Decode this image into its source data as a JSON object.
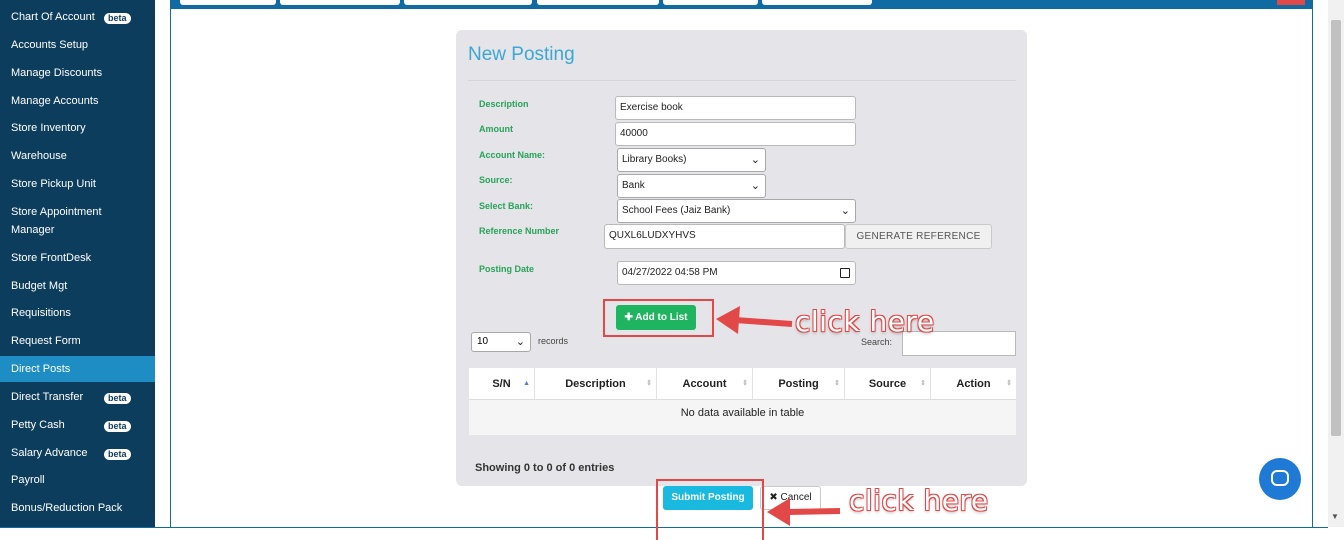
{
  "sidebar": {
    "items": [
      {
        "label": "Chart Of Account",
        "badge": "beta"
      },
      {
        "label": "Accounts Setup"
      },
      {
        "label": "Manage Discounts"
      },
      {
        "label": "Manage Accounts"
      },
      {
        "label": "Store Inventory"
      },
      {
        "label": "Warehouse"
      },
      {
        "label": "Store Pickup Unit"
      },
      {
        "label": "Store Appointment Manager"
      },
      {
        "label": "Store FrontDesk"
      },
      {
        "label": "Budget Mgt"
      },
      {
        "label": "Requisitions"
      },
      {
        "label": "Request Form"
      },
      {
        "label": "Direct Posts",
        "active": true
      },
      {
        "label": "Direct Transfer",
        "badge": "beta"
      },
      {
        "label": "Petty Cash",
        "badge": "beta"
      },
      {
        "label": "Salary Advance",
        "badge": "beta"
      },
      {
        "label": "Payroll"
      },
      {
        "label": "Bonus/Reduction Pack"
      }
    ]
  },
  "form": {
    "title": "New Posting",
    "description_label": "Description",
    "description_value": "Exercise book",
    "amount_label": "Amount",
    "amount_value": "40000",
    "account_label": "Account Name:",
    "account_value": "Library Books)",
    "source_label": "Source:",
    "source_value": "Bank",
    "bank_label": "Select Bank:",
    "bank_value": "School Fees (Jaiz Bank)",
    "reference_label": "Reference Number",
    "reference_value": "QUXL6LUDXYHVS",
    "generate_label": "GENERATE REFERENCE",
    "date_label": "Posting Date",
    "date_value": "04/27/2022 04:58 PM",
    "add_label": "Add to List"
  },
  "table": {
    "length_value": "10",
    "records_label": "records",
    "search_label": "Search:",
    "columns": [
      "S/N",
      "Description",
      "Account",
      "Posting",
      "Source",
      "Action"
    ],
    "empty_text": "No data available in table",
    "info": "Showing 0 to 0 of 0 entries"
  },
  "actions": {
    "submit_label": "Submit Posting",
    "cancel_label": "Cancel"
  },
  "annotations": {
    "click_here_1": "click here",
    "click_here_2": "click here"
  },
  "colors": {
    "sidebar": "#0d3d5c",
    "active": "#1d8dc4",
    "green": "#1fb45f",
    "cyan": "#1ab9e0",
    "annotation_red": "#e34848"
  }
}
